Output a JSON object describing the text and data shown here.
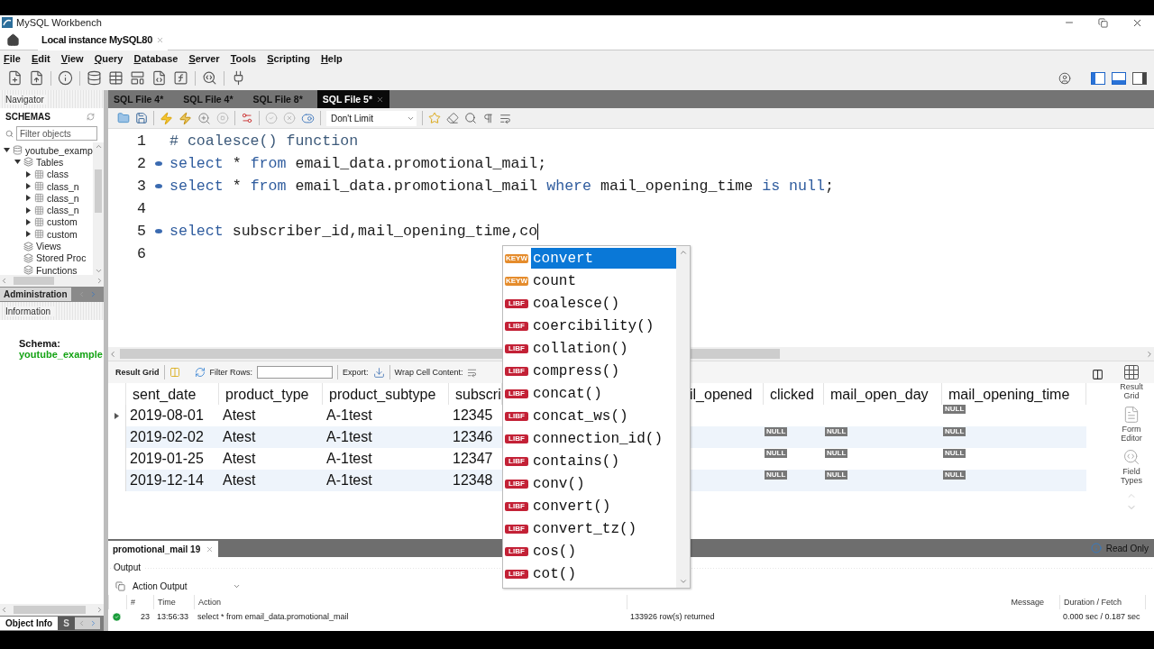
{
  "window": {
    "title": "MySQL Workbench"
  },
  "connection_tab": {
    "label": "Local instance MySQL80"
  },
  "menu": [
    "File",
    "Edit",
    "View",
    "Query",
    "Database",
    "Server",
    "Tools",
    "Scripting",
    "Help"
  ],
  "panel_toggles": [
    {
      "selected": true
    },
    {
      "selected": true
    },
    {
      "selected": false
    }
  ],
  "navigator": {
    "title": "Navigator",
    "schemas_label": "SCHEMAS",
    "filter": {
      "placeholder": "Filter objects"
    },
    "tree": [
      {
        "label": "youtube_examp",
        "kind": "schema",
        "expanded": true,
        "children": [
          {
            "label": "Tables",
            "kind": "folder",
            "expanded": true,
            "children": [
              {
                "label": "class",
                "kind": "table",
                "expanded": false
              },
              {
                "label": "class_n",
                "kind": "table",
                "expanded": false
              },
              {
                "label": "class_n",
                "kind": "table",
                "expanded": false
              },
              {
                "label": "class_n",
                "kind": "table",
                "expanded": false
              },
              {
                "label": "custom",
                "kind": "table",
                "expanded": false
              },
              {
                "label": "custom",
                "kind": "table",
                "expanded": false
              }
            ]
          },
          {
            "label": "Views",
            "kind": "folder"
          },
          {
            "label": "Stored Proc",
            "kind": "folder"
          },
          {
            "label": "Functions",
            "kind": "folder"
          }
        ]
      }
    ],
    "admin_tab": {
      "label": "Administration"
    },
    "information": {
      "title": "Information",
      "schema_label": "Schema:",
      "schema_name": "youtube_example"
    },
    "bottom_tabs": [
      {
        "label": "Object Info",
        "selected": true
      },
      {
        "label": "S",
        "selected": false
      }
    ]
  },
  "editor": {
    "tabs": [
      {
        "label": "SQL File 4*",
        "selected": false
      },
      {
        "label": "SQL File 4*",
        "selected": false
      },
      {
        "label": "SQL File 8*",
        "selected": false
      },
      {
        "label": "SQL File 5*",
        "selected": true
      }
    ],
    "limit": "Don't Limit",
    "lines": [
      {
        "number": "1",
        "marker": false,
        "tokens": [
          {
            "text": "# coalesce() function",
            "kind": "comment"
          }
        ]
      },
      {
        "number": "2",
        "marker": true,
        "tokens": [
          {
            "text": "select",
            "kind": "keyword"
          },
          {
            "text": " * ",
            "kind": "plain"
          },
          {
            "text": "from",
            "kind": "keyword"
          },
          {
            "text": " email_data.promotional_mail;",
            "kind": "plain"
          }
        ]
      },
      {
        "number": "3",
        "marker": true,
        "tokens": [
          {
            "text": "select",
            "kind": "keyword"
          },
          {
            "text": " * ",
            "kind": "plain"
          },
          {
            "text": "from",
            "kind": "keyword"
          },
          {
            "text": " email_data.promotional_mail ",
            "kind": "plain"
          },
          {
            "text": "where",
            "kind": "keyword"
          },
          {
            "text": " mail_opening_time ",
            "kind": "plain"
          },
          {
            "text": "is null",
            "kind": "keyword"
          },
          {
            "text": ";",
            "kind": "plain"
          }
        ]
      },
      {
        "number": "4",
        "marker": false
      },
      {
        "number": "5",
        "marker": true,
        "cursor": true,
        "tokens": [
          {
            "text": "select",
            "kind": "keyword"
          },
          {
            "text": " subscriber_id,mail_opening_time,co",
            "kind": "plain"
          }
        ]
      },
      {
        "number": "6",
        "marker": false
      }
    ]
  },
  "autocomplete": [
    {
      "badge": "KEYW",
      "kind": "keyword",
      "text": "convert",
      "selected": true
    },
    {
      "badge": "KEYW",
      "kind": "keyword",
      "text": "count",
      "selected": false
    },
    {
      "badge": "LIBF",
      "kind": "function",
      "text": "coalesce()",
      "selected": false
    },
    {
      "badge": "LIBF",
      "kind": "function",
      "text": "coercibility()",
      "selected": false
    },
    {
      "badge": "LIBF",
      "kind": "function",
      "text": "collation()",
      "selected": false
    },
    {
      "badge": "LIBF",
      "kind": "function",
      "text": "compress()",
      "selected": false
    },
    {
      "badge": "LIBF",
      "kind": "function",
      "text": "concat()",
      "selected": false
    },
    {
      "badge": "LIBF",
      "kind": "function",
      "text": "concat_ws()",
      "selected": false
    },
    {
      "badge": "LIBF",
      "kind": "function",
      "text": "connection_id()",
      "selected": false
    },
    {
      "badge": "LIBF",
      "kind": "function",
      "text": "contains()",
      "selected": false
    },
    {
      "badge": "LIBF",
      "kind": "function",
      "text": "conv()",
      "selected": false
    },
    {
      "badge": "LIBF",
      "kind": "function",
      "text": "convert()",
      "selected": false
    },
    {
      "badge": "LIBF",
      "kind": "function",
      "text": "convert_tz()",
      "selected": false
    },
    {
      "badge": "LIBF",
      "kind": "function",
      "text": "cos()",
      "selected": false
    },
    {
      "badge": "LIBF",
      "kind": "function",
      "text": "cot()",
      "selected": false
    }
  ],
  "results": {
    "toolbar": {
      "result_grid": "Result Grid",
      "filter_label": "Filter Rows:",
      "export_label": "Export:",
      "wrap_label": "Wrap Cell Content:"
    },
    "columns": [
      "sent_date",
      "product_type",
      "product_subtype",
      "subscri",
      "il_opened",
      "clicked",
      "mail_open_day",
      "mail_opening_time"
    ],
    "rows": [
      {
        "current": true,
        "cells": [
          "2019-08-01",
          "Atest",
          "A-1test",
          "12345",
          null,
          null,
          null,
          "NULL"
        ]
      },
      {
        "current": false,
        "cells": [
          "2019-02-02",
          "Atest",
          "A-1test",
          "12346",
          null,
          "NULL",
          "NULL",
          "NULL"
        ]
      },
      {
        "current": false,
        "cells": [
          "2019-01-25",
          "Atest",
          "A-1test",
          "12347",
          null,
          "NULL",
          "NULL",
          "NULL"
        ]
      },
      {
        "current": false,
        "cells": [
          "2019-12-14",
          "Atest",
          "A-1test",
          "12348",
          null,
          "NULL",
          "NULL",
          "NULL"
        ]
      }
    ],
    "side_panel": [
      {
        "label": "Result Grid",
        "selected": true
      },
      {
        "label": "Form Editor",
        "selected": false
      },
      {
        "label": "Field Types",
        "selected": false
      }
    ],
    "tab": {
      "label": "promotional_mail 19"
    },
    "read_only": "Read Only"
  },
  "output": {
    "title": "Output",
    "selector": "Action Output",
    "columns": [
      "#",
      "Time",
      "Action",
      "Message",
      "Duration / Fetch"
    ],
    "rows": [
      {
        "cells": [
          "23",
          "13:56:33",
          "select * from email_data.promotional_mail",
          "133926 row(s) returned",
          "0.000 sec / 0.187 sec"
        ]
      }
    ]
  }
}
